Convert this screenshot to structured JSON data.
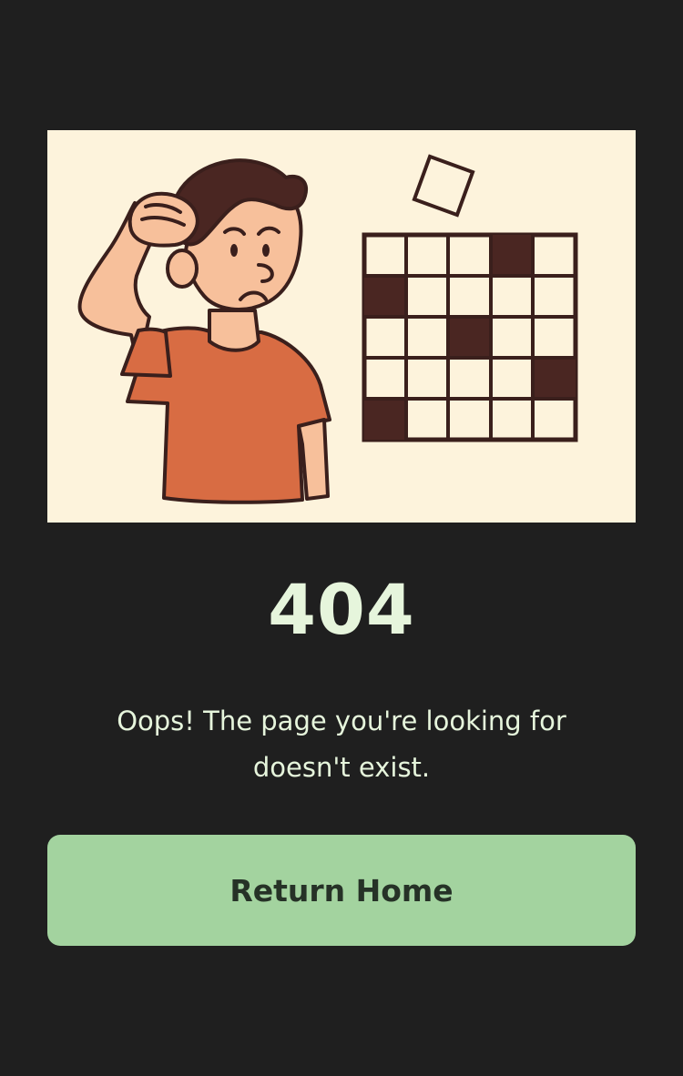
{
  "error": {
    "code": "404",
    "message": "Oops! The page you're looking for doesn't exist."
  },
  "actions": {
    "home_label": "Return Home"
  },
  "colors": {
    "background": "#1f1f1f",
    "illustration_background": "#fdf3dc",
    "text": "#e6f5dc",
    "button": "#a3d39f",
    "button_text": "#263227",
    "shirt": "#d86c43",
    "skin": "#f7c09b",
    "hair": "#4a2622",
    "grid_dark": "#4a2622"
  }
}
